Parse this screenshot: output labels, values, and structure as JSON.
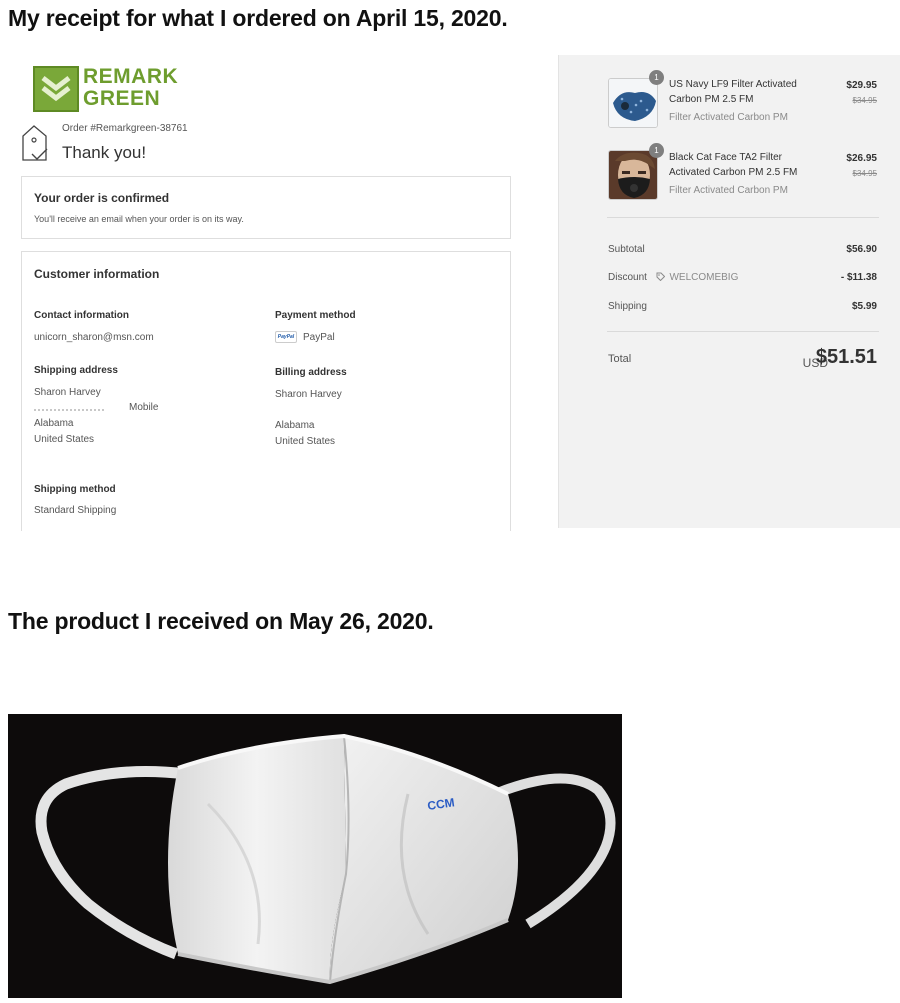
{
  "headings": {
    "receipt": "My receipt for what I ordered on April 15, 2020.",
    "received": "The product I received on May 26, 2020."
  },
  "logo": {
    "line1": "REMARK",
    "line2": "GREEN"
  },
  "order": {
    "number": "Order #Remarkgreen-38761",
    "thank_you": "Thank you!"
  },
  "confirm_card": {
    "title": "Your order is confirmed",
    "text": "You'll receive an email when your order is on its way."
  },
  "customer": {
    "title": "Customer information",
    "contact_label": "Contact information",
    "contact_value": "unicorn_sharon@msn.com",
    "payment_label": "Payment method",
    "payment_value": "PayPal",
    "paypal_badge": "PayPal",
    "shipping_label": "Shipping address",
    "shipping_lines": [
      "Sharon Harvey",
      "Mobile",
      "Alabama",
      "United States"
    ],
    "billing_label": "Billing address",
    "billing_lines": [
      "Sharon Harvey",
      "Alabama",
      "United States"
    ],
    "method_label": "Shipping method",
    "method_value": "Standard Shipping"
  },
  "summary": {
    "items": [
      {
        "qty": "1",
        "name": "US Navy LF9 Filter Activated Carbon PM 2.5 FM",
        "variant": "Filter Activated Carbon PM",
        "price": "$29.95",
        "original_price": "$34.95"
      },
      {
        "qty": "1",
        "name": "Black Cat Face TA2 Filter Activated Carbon PM 2.5 FM",
        "variant": "Filter Activated Carbon PM",
        "price": "$26.95",
        "original_price": "$34.95"
      }
    ],
    "subtotal_label": "Subtotal",
    "subtotal_value": "$56.90",
    "discount_label": "Discount",
    "discount_code": "WELCOMEBIG",
    "discount_value": "- $11.38",
    "shipping_label": "Shipping",
    "shipping_value": "$5.99",
    "total_label": "Total",
    "total_currency": "USD",
    "total_value": "$51.51"
  },
  "photo": {
    "mask_print": "CCM"
  },
  "colors": {
    "brand_green": "#7aa839",
    "summary_bg": "#f2f2f2"
  }
}
